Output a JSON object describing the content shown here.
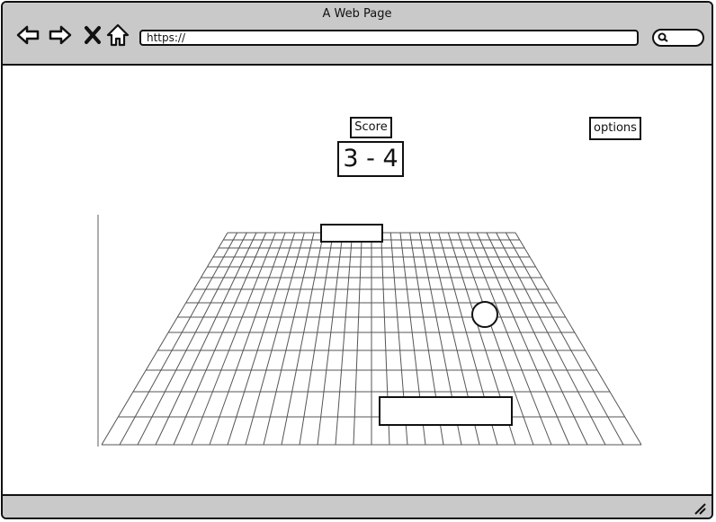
{
  "browser": {
    "title": "A Web Page",
    "url": "https://"
  },
  "icons": {
    "back": "arrow-left-icon",
    "forward": "arrow-right-icon",
    "stop": "close-icon",
    "home": "home-icon",
    "search": "search-icon",
    "resize": "resize-grip-icon"
  },
  "game": {
    "score_label": "Score",
    "score": "3 - 4",
    "options_label": "options"
  }
}
